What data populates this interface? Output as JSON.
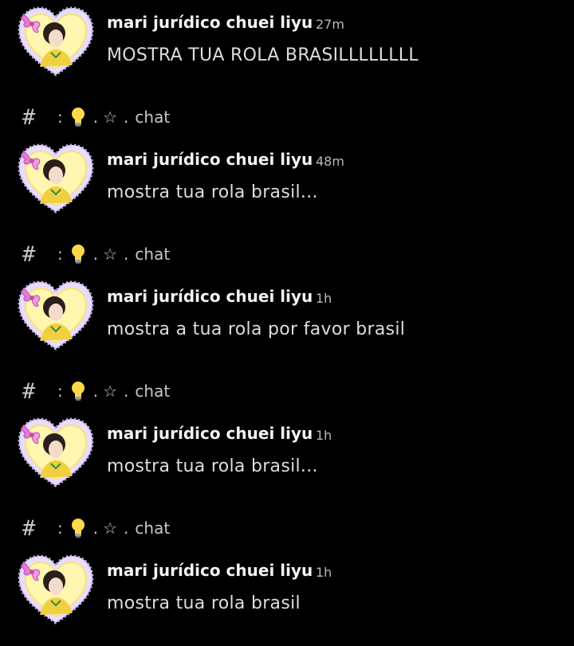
{
  "channel": {
    "hash_icon": "hash-icon",
    "separator": ":",
    "emoji_icon": "light-bulb-icon",
    "dot": ".",
    "star": "☆",
    "dot2": ".",
    "label": "chat"
  },
  "messages": [
    {
      "author": "mari jurídico chuei liyu",
      "time": "27m",
      "text": "MOSTRA TUA ROLA BRASILLLLLLLL"
    },
    {
      "author": "mari jurídico chuei liyu",
      "time": "48m",
      "text": "mostra tua rola brasil..."
    },
    {
      "author": "mari jurídico chuei liyu",
      "time": "1h",
      "text": "mostra a tua rola por favor brasil"
    },
    {
      "author": "mari jurídico chuei liyu",
      "time": "1h",
      "text": "mostra tua rola brasil..."
    },
    {
      "author": "mari jurídico chuei liyu",
      "time": "1h",
      "text": "mostra tua rola brasil"
    }
  ],
  "colors": {
    "background": "#000000",
    "author": "#f2f3f5",
    "timestamp": "#b5bac1",
    "text": "#dbdee1",
    "frame": "#d9c8f5",
    "bow": "#e879d6"
  }
}
